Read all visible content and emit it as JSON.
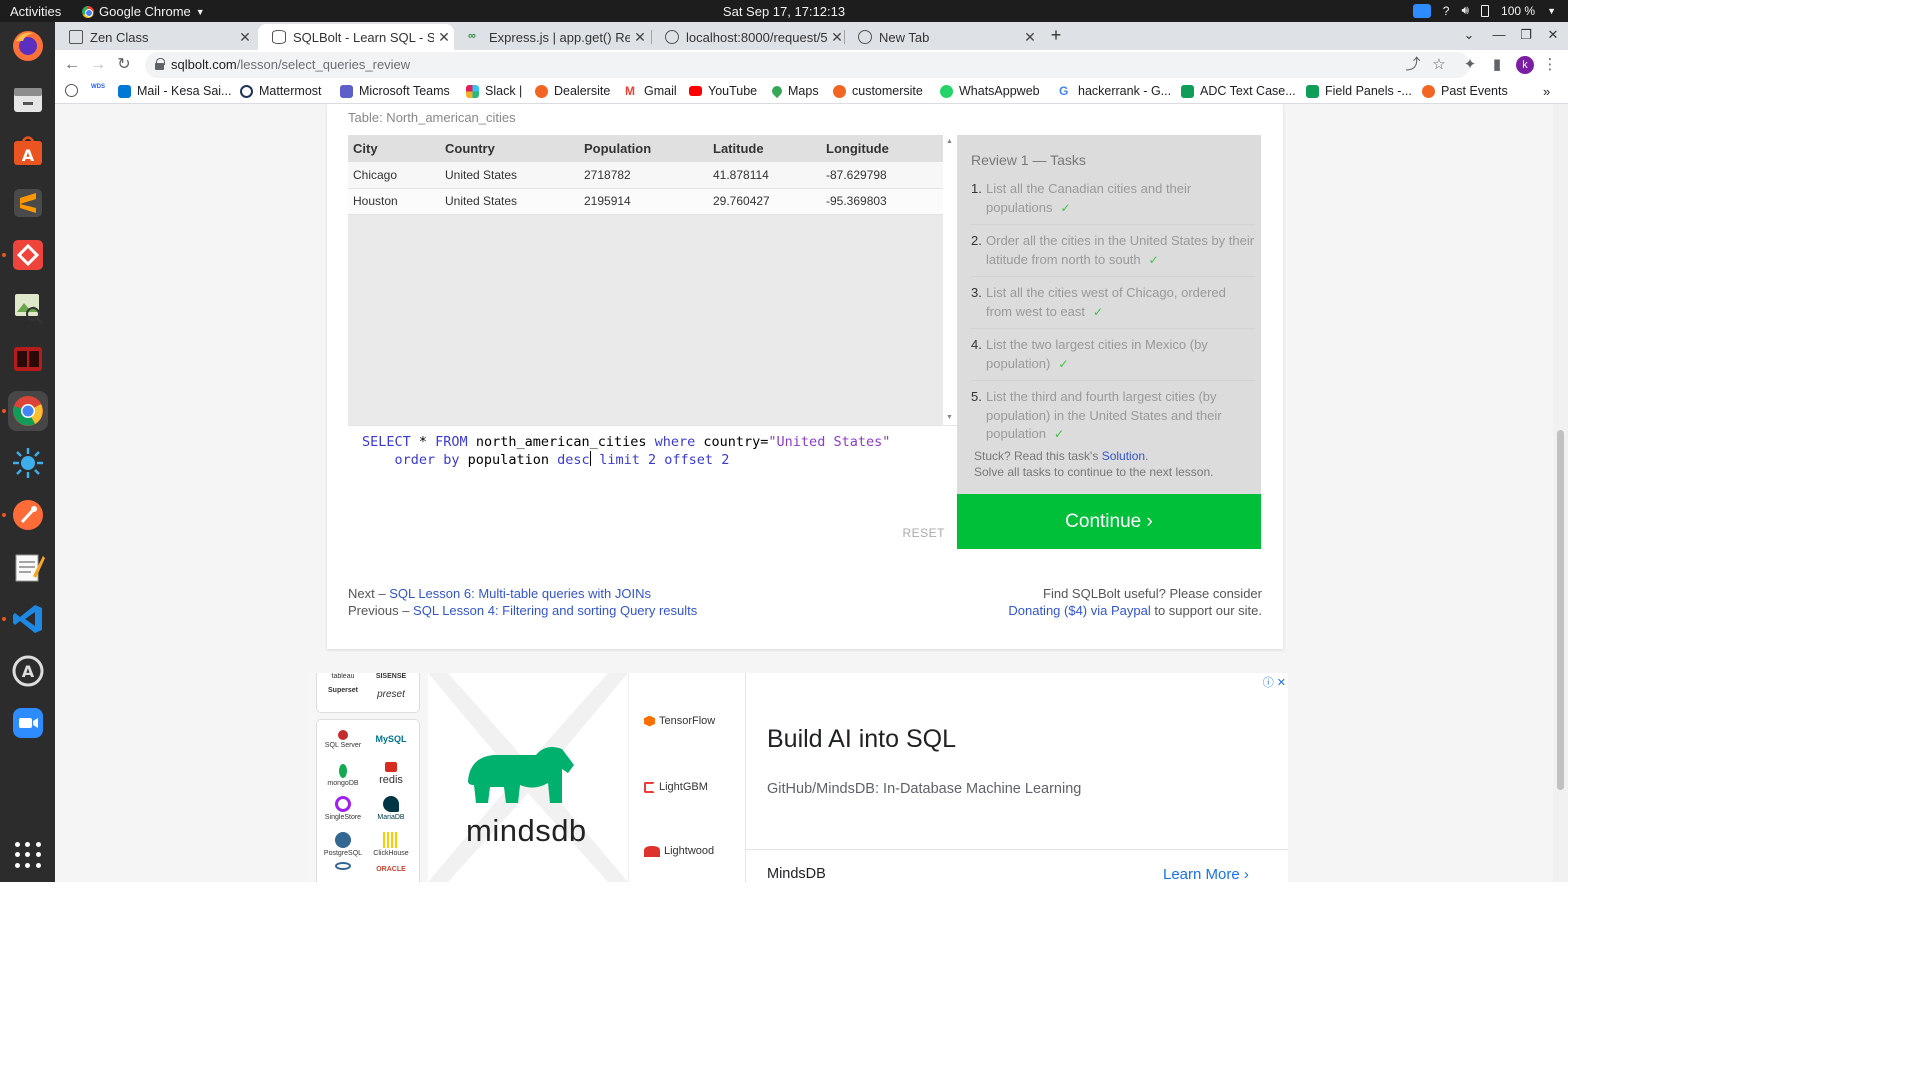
{
  "system_bar": {
    "activities": "Activities",
    "app_name": "Google Chrome",
    "clock": "Sat Sep 17, 17:12:13",
    "battery": "100 %"
  },
  "tabs": [
    {
      "title": "Zen Class",
      "active": false
    },
    {
      "title": "SQLBolt - Learn SQL - SQL",
      "active": true
    },
    {
      "title": "Express.js | app.get() Req",
      "active": false
    },
    {
      "title": "localhost:8000/request/5",
      "active": false
    },
    {
      "title": "New Tab",
      "active": false
    }
  ],
  "address_bar": {
    "domain": "sqlbolt.com",
    "path": "/lesson/select_queries_review"
  },
  "bookmarks": [
    {
      "label": "",
      "icon": "globe-icon"
    },
    {
      "label": "",
      "icon": "wds-icon"
    },
    {
      "label": "Mail - Kesa Sai...",
      "icon": "outlook-icon"
    },
    {
      "label": "Mattermost",
      "icon": "mattermost-icon"
    },
    {
      "label": "Microsoft Teams",
      "icon": "teams-icon"
    },
    {
      "label": "Slack |",
      "icon": "slack-icon"
    },
    {
      "label": "Dealersite",
      "icon": "dealersite-icon"
    },
    {
      "label": "Gmail",
      "icon": "gmail-icon"
    },
    {
      "label": "YouTube",
      "icon": "youtube-icon"
    },
    {
      "label": "Maps",
      "icon": "maps-icon"
    },
    {
      "label": "customersite",
      "icon": "customersite-icon"
    },
    {
      "label": "WhatsAppweb",
      "icon": "whatsapp-icon"
    },
    {
      "label": "hackerrank - G...",
      "icon": "google-icon"
    },
    {
      "label": "ADC Text Case...",
      "icon": "sheets-icon"
    },
    {
      "label": "Field Panels -...",
      "icon": "sheets-icon"
    },
    {
      "label": "Past Events",
      "icon": "events-icon"
    }
  ],
  "lesson": {
    "table_caption": "Table: North_american_cities",
    "columns": [
      "City",
      "Country",
      "Population",
      "Latitude",
      "Longitude"
    ],
    "rows": [
      [
        "Chicago",
        "United States",
        "2718782",
        "41.878114",
        "-87.629798"
      ],
      [
        "Houston",
        "United States",
        "2195914",
        "29.760427",
        "-95.369803"
      ]
    ],
    "query": {
      "line1": {
        "kw1": "SELECT",
        "mid1": " * ",
        "kw2": "FROM",
        "ident": " north_american_cities ",
        "kw3": "where",
        "cond": " country=",
        "str": "\"United States\""
      },
      "line2": {
        "indent": "    ",
        "kw1": "order by",
        "ident": " population ",
        "kw2": "desc",
        "kw3": " limit ",
        "n1": "2",
        "kw4": " offset ",
        "n2": "2"
      }
    },
    "reset_label": "RESET",
    "tasks_title": "Review 1 — Tasks",
    "tasks": [
      {
        "num": "1.",
        "text": "List all the Canadian cities and their populations",
        "done": "✓"
      },
      {
        "num": "2.",
        "text": "Order all the cities in the United States by their latitude from north to south",
        "done": "✓"
      },
      {
        "num": "3.",
        "text": "List all the cities west of Chicago, ordered from west to east",
        "done": "✓"
      },
      {
        "num": "4.",
        "text": "List the two largest cities in Mexico (by population)",
        "done": "✓"
      },
      {
        "num": "5.",
        "text": "List the third and fourth largest cities (by population) in the United States and their population",
        "done": "✓"
      }
    ],
    "hint_prefix": "Stuck? Read this task's ",
    "hint_link": "Solution",
    "hint_suffix": ".",
    "hint_line2": "Solve all tasks to continue to the next lesson.",
    "continue_label": "Continue ›",
    "next_prefix": "Next – ",
    "next_link": "SQL Lesson 6: Multi-table queries with JOINs",
    "prev_prefix": "Previous – ",
    "prev_link": "SQL Lesson 4: Filtering and sorting Query results",
    "support_line1": "Find SQLBolt useful? Please consider",
    "support_link": "Donating ($4) via Paypal",
    "support_suffix": " to support our site."
  },
  "ad": {
    "logo_text": "mindsdb",
    "tools": [
      "TensorFlow",
      "LightGBM",
      "Lightwood"
    ],
    "db_logos": [
      "tableau",
      "SISENSE",
      "Superset",
      "preset",
      "SQL Server",
      "MySQL",
      "mongoDB",
      "redis",
      "SingleStore",
      "MariaDB",
      "PostgreSQL",
      "ClickHouse",
      "",
      "ORACLE"
    ],
    "headline": "Build AI into SQL",
    "description": "GitHub/MindsDB: In-Database Machine Learning",
    "brand": "MindsDB",
    "cta": "Learn More",
    "cta_arrow": "›"
  }
}
